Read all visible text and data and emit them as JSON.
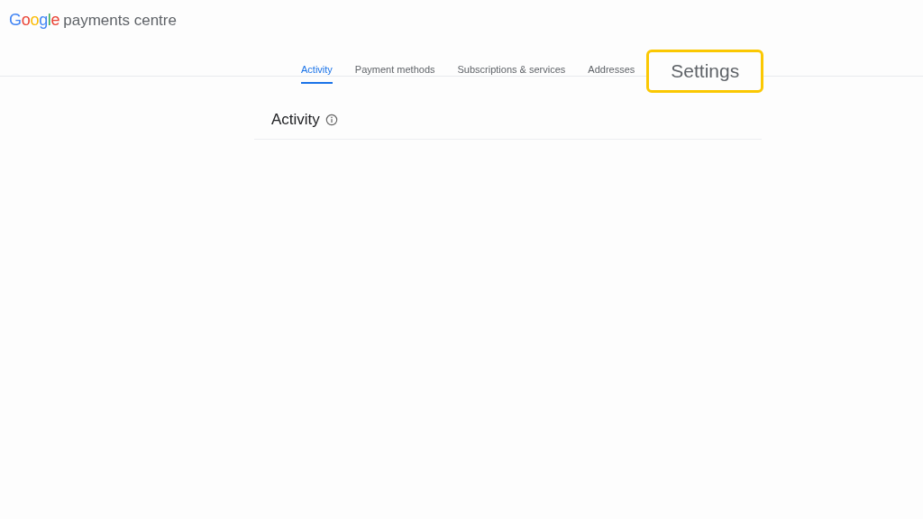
{
  "header": {
    "logo": "Google",
    "product": "payments centre"
  },
  "tabs": [
    {
      "label": "Activity",
      "selected": true,
      "highlighted": false
    },
    {
      "label": "Payment methods",
      "selected": false,
      "highlighted": false
    },
    {
      "label": "Subscriptions & services",
      "selected": false,
      "highlighted": false
    },
    {
      "label": "Addresses",
      "selected": false,
      "highlighted": false
    },
    {
      "label": "Settings",
      "selected": false,
      "highlighted": true
    }
  ],
  "section": {
    "title": "Activity"
  }
}
